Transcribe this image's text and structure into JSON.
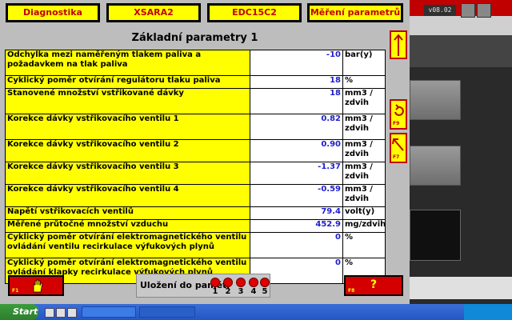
{
  "tabs": [
    {
      "label": "Diagnostika"
    },
    {
      "label": "XSARA2"
    },
    {
      "label": "EDC15C2"
    },
    {
      "label": "Měření parametrů"
    }
  ],
  "version": "v08.02",
  "panel_title": "Základní parametry 1",
  "rows": [
    {
      "label": "Odchylka mezi naměřeným tlakem paliva a požadavkem na tlak paliva",
      "value": "-10",
      "unit": "bar(y)"
    },
    {
      "label": "Cyklický poměr otvírání regulátoru tlaku paliva",
      "value": "18",
      "unit": "%"
    },
    {
      "label": "Stanovené množství vstřikované dávky",
      "value": "18",
      "unit": "mm3 / zdvih"
    },
    {
      "label": "Korekce dávky vstřikovacího ventilu 1",
      "value": "0.82",
      "unit": "mm3 / zdvih"
    },
    {
      "label": "Korekce dávky vstřikovacího ventilu 2",
      "value": "0.90",
      "unit": "mm3 / zdvih"
    },
    {
      "label": "Korekce dávky vstřikovacího ventilu 3",
      "value": "-1.37",
      "unit": "mm3 / zdvih"
    },
    {
      "label": "Korekce dávky vstřikovacího ventilu 4",
      "value": "-0.59",
      "unit": "mm3 / zdvih"
    },
    {
      "label": "Napětí vstřikovacích ventilů",
      "value": "79.4",
      "unit": "volt(y)"
    },
    {
      "label": "Měřené průtočné množství vzduchu",
      "value": "452.9",
      "unit": "mg/zdvih"
    },
    {
      "label": "Cyklický poměr otvírání elektromagnetického ventilu ovládání ventilu recirkulace výfukových plynů",
      "value": "0",
      "unit": "%"
    },
    {
      "label": "Cyklický poměr otvírání elektromagnetického ventilu ovládání klapky recirkulace výfukových plynů",
      "value": "0",
      "unit": "%"
    }
  ],
  "side_buttons": {
    "up": {
      "icon": "arrow-up-icon"
    },
    "refresh": {
      "icon": "refresh-icon",
      "key": "F9"
    },
    "graph": {
      "icon": "diagonal-arrow-icon",
      "key": "F7"
    }
  },
  "bottom": {
    "hand": {
      "icon": "hand-icon",
      "key": "F1"
    },
    "memory_label": "Uložení do paměti",
    "memory_slots": [
      "1",
      "2",
      "3",
      "4",
      "5"
    ],
    "help": {
      "label": "?",
      "key": "F8"
    }
  },
  "taskbar": {
    "start_label": "Start"
  },
  "colors": {
    "tab_bg": "#ffff00",
    "tab_text": "#c00000",
    "label_bg": "#ffff00",
    "value_text": "#1e1ed0",
    "button_red": "#d40000"
  }
}
